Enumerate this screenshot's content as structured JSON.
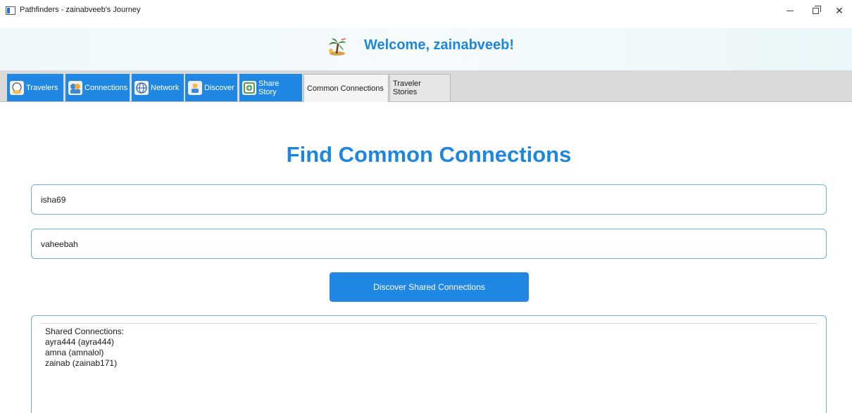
{
  "window": {
    "title": "Pathfinders - zainabveeb's Journey"
  },
  "header": {
    "logo_icon": "palm-tree-airplane-icon",
    "welcome": "Welcome, zainabveeb!"
  },
  "tabs": [
    {
      "label": "Travelers",
      "icon": "traveler-icon",
      "style": "blue"
    },
    {
      "label": "Connections",
      "icon": "connections-icon",
      "style": "blue"
    },
    {
      "label": "Network",
      "icon": "globe-icon",
      "style": "blue"
    },
    {
      "label": "Discover",
      "icon": "discover-person-icon",
      "style": "blue"
    },
    {
      "label": "Share Story",
      "icon": "share-story-icon",
      "style": "blue"
    },
    {
      "label": "Common Connections",
      "icon": "",
      "style": "active"
    },
    {
      "label": "Traveler Stories",
      "icon": "",
      "style": "plain"
    }
  ],
  "main": {
    "title": "Find Common Connections",
    "user1_value": "isha69",
    "user2_value": "vaheebah",
    "button_label": "Discover Shared Connections",
    "results": {
      "heading": "Shared Connections:",
      "items": [
        "ayra444 (ayra444)",
        "amna (amnalol)",
        "zainab (zainab171)"
      ]
    }
  },
  "colors": {
    "accent": "#2087e3",
    "title_blue": "#1f86dd",
    "input_border": "#6aaee8"
  }
}
